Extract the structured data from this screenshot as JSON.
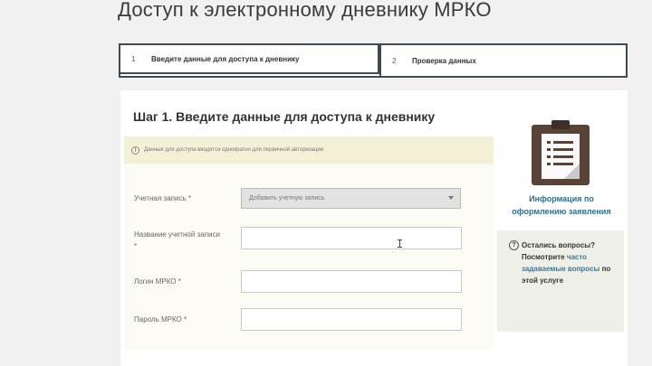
{
  "page": {
    "title": "Доступ к электронному дневнику МРКО"
  },
  "stepper": {
    "steps": [
      {
        "number": "1",
        "label": "Введите данные для доступа к дневнику"
      },
      {
        "number": "2",
        "label": "Проверка данных"
      }
    ]
  },
  "step1": {
    "heading": "Шаг 1. Введите данные для доступа к дневнику",
    "notice": "Данные для доступа вводятся однократно для первичной авторизации"
  },
  "form": {
    "account_label": "Учетная запись *",
    "account_select_value": "Добавить учетную запись",
    "account_name_label": "Название учетной записи *",
    "login_label": "Логин МРКО *",
    "password_label": "Пароль МРКО *"
  },
  "sidebar": {
    "info_link": "Информация по оформлению заявления",
    "faq_prefix": "Остались вопросы? Посмотрите",
    "faq_link": "часто задаваемые вопросы",
    "faq_suffix": "по этой услуге"
  },
  "icons": {
    "notice": "info-icon",
    "select": "chevron-down-icon",
    "sidebar_document": "clipboard-icon",
    "faq": "question-icon"
  },
  "colors": {
    "link": "#2d6e8c",
    "stepper_border": "#3d4a52",
    "notice_background": "#f3f0d6",
    "clipboard": "#574436"
  }
}
